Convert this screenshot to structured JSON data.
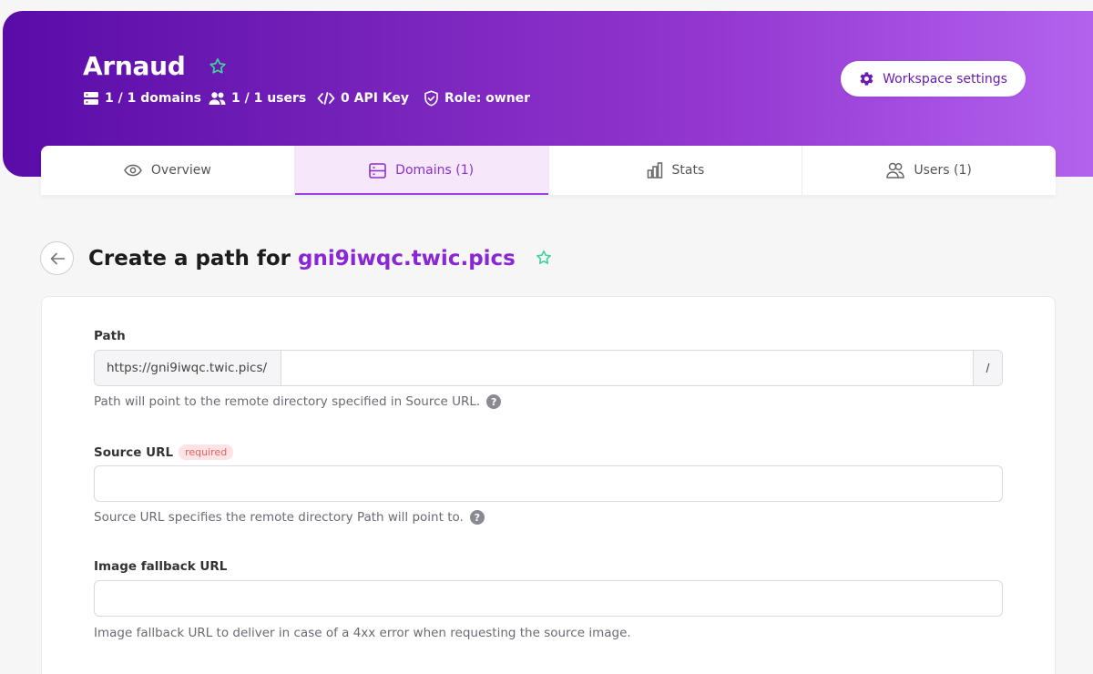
{
  "workspace": {
    "name": "Arnaud",
    "meta": {
      "domains": "1 / 1 domains",
      "users": "1 / 1 users",
      "api_key": "0 API Key",
      "role": "Role: owner"
    },
    "settings_button": "Workspace settings"
  },
  "tabs": [
    {
      "label": "Overview",
      "icon": "eye-icon",
      "active": false
    },
    {
      "label": "Domains (1)",
      "icon": "server-icon",
      "active": true
    },
    {
      "label": "Stats",
      "icon": "bar-chart-icon",
      "active": false
    },
    {
      "label": "Users (1)",
      "icon": "users-icon",
      "active": false
    }
  ],
  "page": {
    "title_prefix": "Create a path for ",
    "domain": "gni9iwqc.twic.pics"
  },
  "form": {
    "path": {
      "label": "Path",
      "prefix": "https://gni9iwqc.twic.pics/",
      "value": "",
      "suffix": "/",
      "help": "Path will point to the remote directory specified in Source URL."
    },
    "source_url": {
      "label": "Source URL",
      "badge": "required",
      "value": "",
      "help": "Source URL specifies the remote directory Path will point to."
    },
    "fallback_url": {
      "label": "Image fallback URL",
      "value": "",
      "help": "Image fallback URL to deliver in case of a 4xx error when requesting the source image."
    },
    "help_icon_glyph": "?"
  },
  "colors": {
    "accent": "#8a26d4",
    "banner_start": "#5a0ba8",
    "banner_end": "#b362ee",
    "star": "#3fd39a",
    "required_bg": "#fde3e3",
    "required_text": "#e06262"
  }
}
